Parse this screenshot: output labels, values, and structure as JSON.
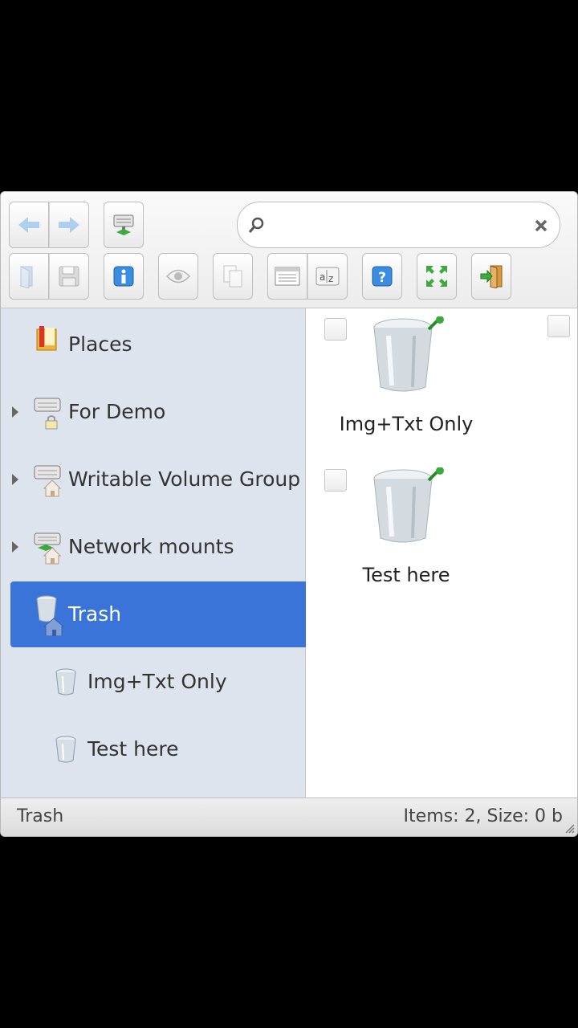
{
  "search": {
    "value": "",
    "placeholder": ""
  },
  "toolbar": {
    "buttons": [
      "back",
      "forward",
      "netmount",
      "open-folder",
      "save",
      "info",
      "preview",
      "copy",
      "view-list",
      "sort",
      "help",
      "fullscreen",
      "exit"
    ]
  },
  "sidebar": {
    "items": [
      {
        "label": "Places",
        "icon": "places-icon"
      },
      {
        "label": "For Demo",
        "icon": "drive-locked-icon",
        "expandable": true
      },
      {
        "label": "Writable Volume Group",
        "icon": "drive-home-icon",
        "expandable": true
      },
      {
        "label": "Network mounts",
        "icon": "network-drive-icon",
        "expandable": true
      },
      {
        "label": "Trash",
        "icon": "trash-icon",
        "selected": true
      },
      {
        "label": "Img+Txt Only",
        "icon": "trash-icon"
      },
      {
        "label": "Test here",
        "icon": "trash-icon"
      }
    ]
  },
  "content": {
    "files": [
      {
        "name": "Img+Txt Only",
        "icon": "trash-pinned-icon"
      },
      {
        "name": "Test here",
        "icon": "trash-pinned-icon"
      }
    ]
  },
  "statusbar": {
    "path": "Trash",
    "info": "Items: 2, Size: 0 b"
  },
  "colors": {
    "selection": "#3b74d8",
    "sidebar_bg": "#dde4ee"
  }
}
